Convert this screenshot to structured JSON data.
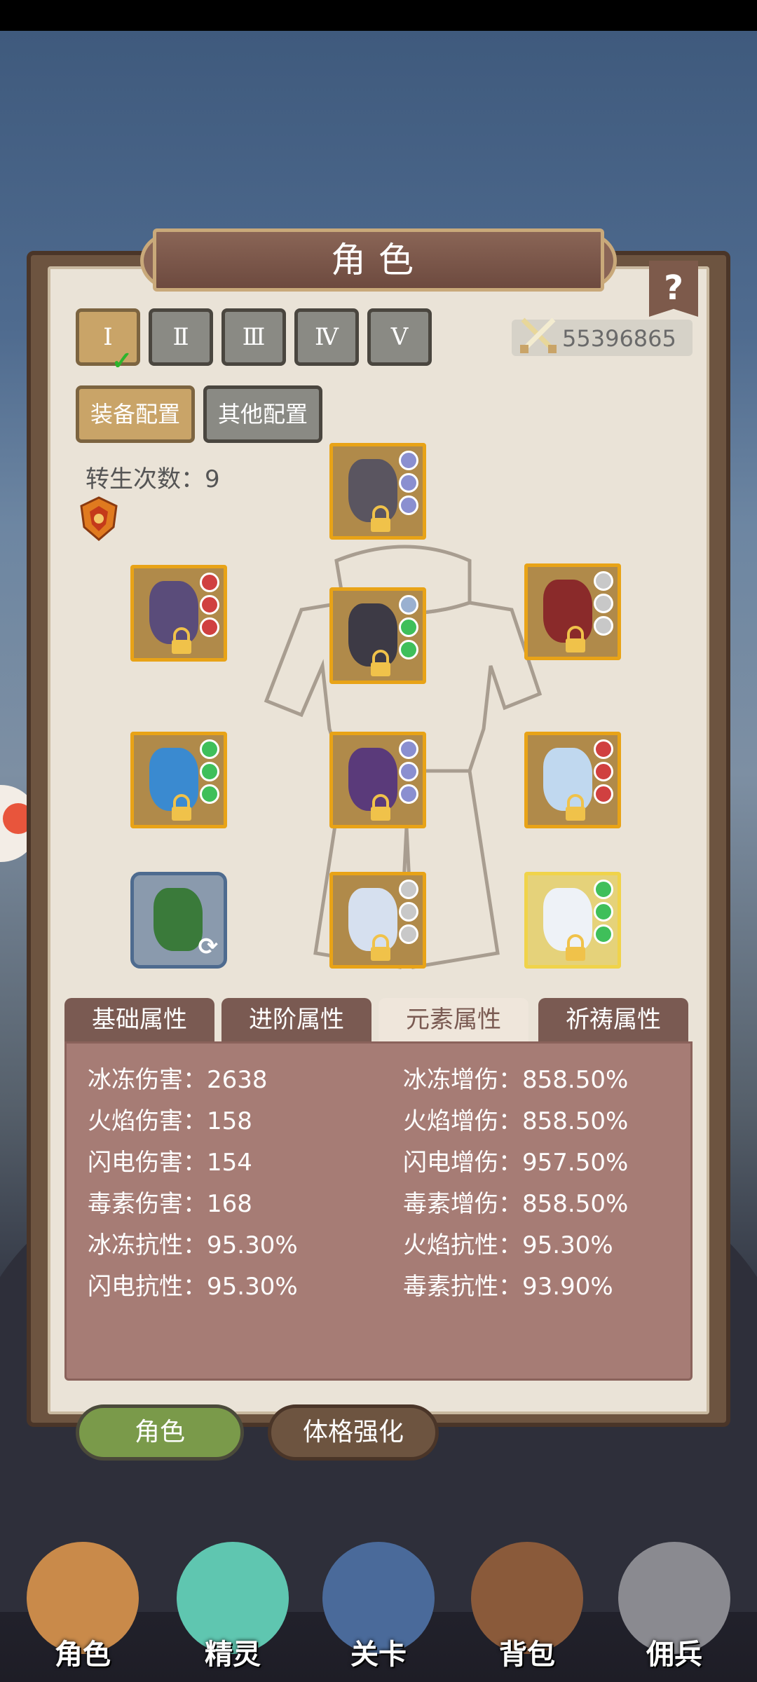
{
  "title": "角色",
  "help_label": "?",
  "preset_tabs": [
    "Ⅰ",
    "Ⅱ",
    "Ⅲ",
    "Ⅳ",
    "Ⅴ"
  ],
  "active_preset": 0,
  "combat_power": "55396865",
  "config_buttons": [
    "装备配置",
    "其他配置"
  ],
  "rebirth": {
    "label": "转生次数：9"
  },
  "stat_tabs": [
    "基础属性",
    "进阶属性",
    "元素属性",
    "祈祷属性"
  ],
  "active_stat_tab": 2,
  "stats_left": [
    "冰冻伤害：2638",
    "火焰伤害：158",
    "闪电伤害：154",
    "毒素伤害：168",
    "冰冻抗性：95.30%",
    "闪电抗性：95.30%"
  ],
  "stats_right": [
    "冰冻增伤：858.50%",
    "火焰增伤：858.50%",
    "闪电增伤：957.50%",
    "毒素增伤：858.50%",
    "火焰抗性：95.30%",
    "毒素抗性：93.90%"
  ],
  "bottom_buttons": [
    "角色",
    "体格强化"
  ],
  "nav_items": [
    "角色",
    "精灵",
    "关卡",
    "背包",
    "佣兵"
  ],
  "colors": {
    "accent_green": "#7a9a4a",
    "panel": "#eae3d7",
    "stat_panel": "#a67c75",
    "slot_border": "#e8a317"
  },
  "equipment_icons": [
    "helmet-icon",
    "scythe-icon",
    "armor-icon",
    "shoulder-icon",
    "gem-icon",
    "belt-icon",
    "crystal-icon",
    "cloak-icon",
    "boots-icon",
    "relic-icon"
  ]
}
